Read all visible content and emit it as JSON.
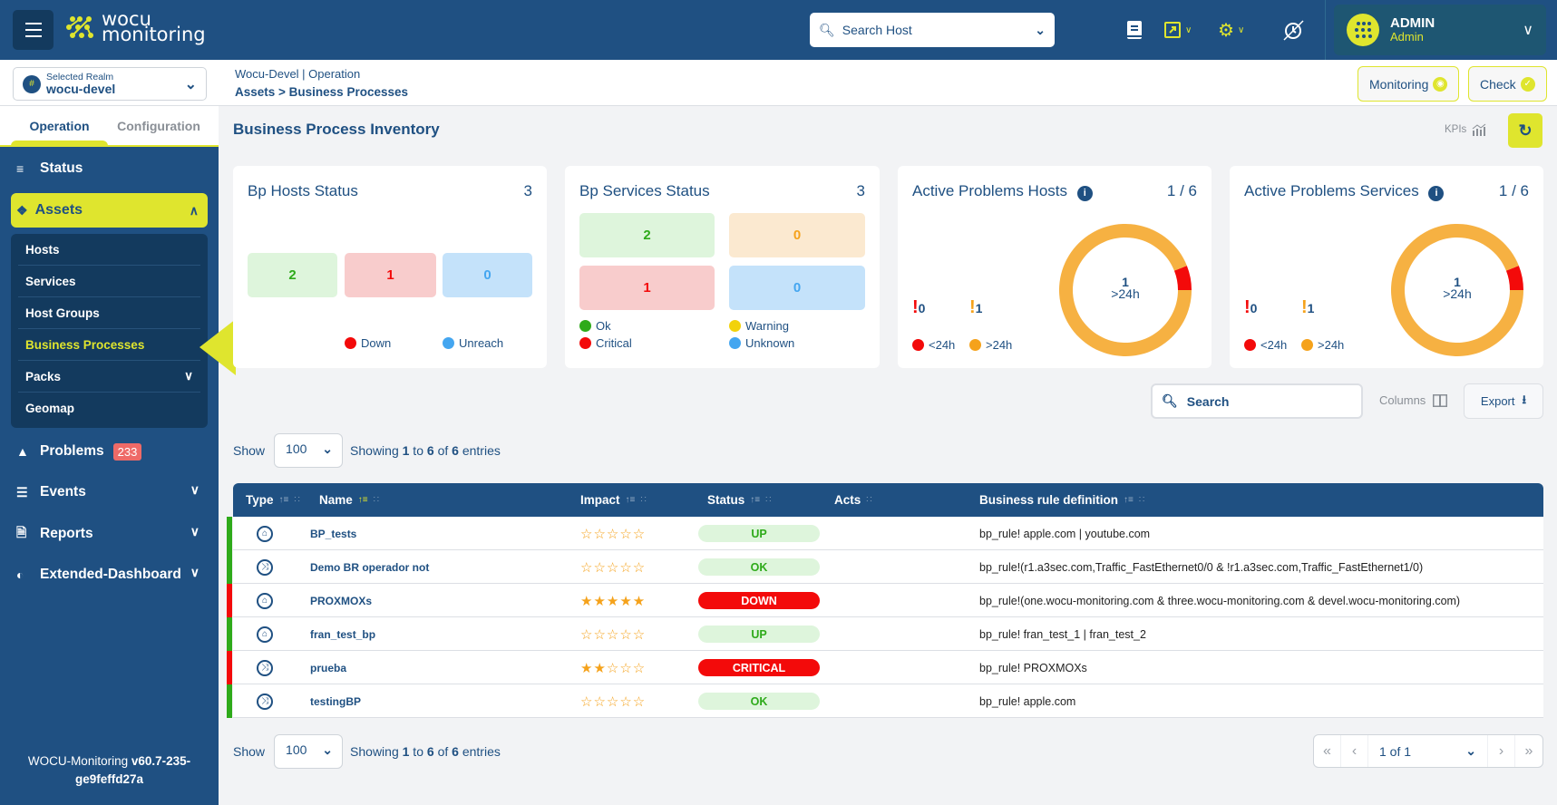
{
  "header": {
    "logo_line1": "wocu",
    "logo_line2": "monitoring",
    "host_search_placeholder": "Search Host",
    "user_name": "ADMIN",
    "user_role": "Admin"
  },
  "realm": {
    "label": "Selected Realm",
    "value": "wocu-devel"
  },
  "breadcrumb": {
    "line1": "Wocu-Devel | Operation",
    "line2": "Assets > Business Processes"
  },
  "top_buttons": {
    "monitoring": "Monitoring",
    "check": "Check"
  },
  "sidebar": {
    "tabs": [
      "Operation",
      "Configuration"
    ],
    "status": "Status",
    "assets": "Assets",
    "submenu": [
      "Hosts",
      "Services",
      "Host Groups",
      "Business Processes",
      "Packs",
      "Geomap"
    ],
    "problems": "Problems",
    "problems_count": "233",
    "events": "Events",
    "reports": "Reports",
    "extended": "Extended-Dashboard",
    "version_prefix": "WOCU-Monitoring ",
    "version_bold1": "v60.7-235-",
    "version_bold2": "ge9feffd27a"
  },
  "page": {
    "title": "Business Process Inventory",
    "kpis": "KPIs"
  },
  "cards": {
    "hosts": {
      "title": "Bp Hosts Status",
      "count": "3",
      "up": "2",
      "down": "1",
      "unreach": "0",
      "legend_down": "Down",
      "legend_unreach": "Unreach"
    },
    "services": {
      "title": "Bp Services Status",
      "count": "3",
      "ok": "2",
      "warning": "0",
      "critical": "1",
      "unknown": "0",
      "legend": [
        "Ok",
        "Warning",
        "Critical",
        "Unknown"
      ]
    },
    "problems_hosts": {
      "title": "Active Problems Hosts",
      "count": "1 / 6",
      "lt24": "0",
      "gt24": "1",
      "center_value": "1",
      "center_label": ">24h",
      "legend_lt": "<24h",
      "legend_gt": ">24h",
      "slice_lt24_fraction": 0.06,
      "slice_gt24_fraction": 0.94
    },
    "problems_services": {
      "title": "Active Problems Services",
      "count": "1 / 6",
      "lt24": "0",
      "gt24": "1",
      "center_value": "1",
      "center_label": ">24h",
      "legend_lt": "<24h",
      "legend_gt": ">24h",
      "slice_lt24_fraction": 0.06,
      "slice_gt24_fraction": 0.94
    }
  },
  "toolbar": {
    "search_placeholder": "Search",
    "columns": "Columns",
    "export": "Export",
    "show_label": "Show",
    "page_size": "100",
    "showing_prefix": "Showing ",
    "showing_from": "1",
    "showing_to_word": " to ",
    "showing_to": "6",
    "showing_of_word": " of ",
    "showing_total": "6",
    "showing_suffix": " entries"
  },
  "table": {
    "columns": [
      "Type",
      "Name",
      "Impact",
      "Status",
      "Acts",
      "Business rule definition"
    ],
    "rows": [
      {
        "type": "host",
        "name": "BP_tests",
        "impact": 0,
        "status": "UP",
        "rule": "bp_rule! apple.com | youtube.com"
      },
      {
        "type": "service",
        "name": "Demo BR operador not",
        "impact": 0,
        "status": "OK",
        "rule": "bp_rule!(r1.a3sec.com,Traffic_FastEthernet0/0 & !r1.a3sec.com,Traffic_FastEthernet1/0)"
      },
      {
        "type": "host",
        "name": "PROXMOXs",
        "impact": 5,
        "status": "DOWN",
        "rule": "bp_rule!(one.wocu-monitoring.com & three.wocu-monitoring.com & devel.wocu-monitoring.com)"
      },
      {
        "type": "host",
        "name": "fran_test_bp",
        "impact": 0,
        "status": "UP",
        "rule": "bp_rule! fran_test_1 | fran_test_2"
      },
      {
        "type": "service",
        "name": "prueba",
        "impact": 2,
        "status": "CRITICAL",
        "rule": "bp_rule! PROXMOXs"
      },
      {
        "type": "service",
        "name": "testingBP",
        "impact": 0,
        "status": "OK",
        "rule": "bp_rule! apple.com"
      }
    ]
  },
  "pager": {
    "label": "1 of 1"
  },
  "colors": {
    "brand": "#1f5082",
    "accent": "#dfe52e",
    "ok": "#2eaa1a",
    "critical": "#f30a0a",
    "warning": "#f5a21b",
    "unknown": "#44a6f0"
  }
}
